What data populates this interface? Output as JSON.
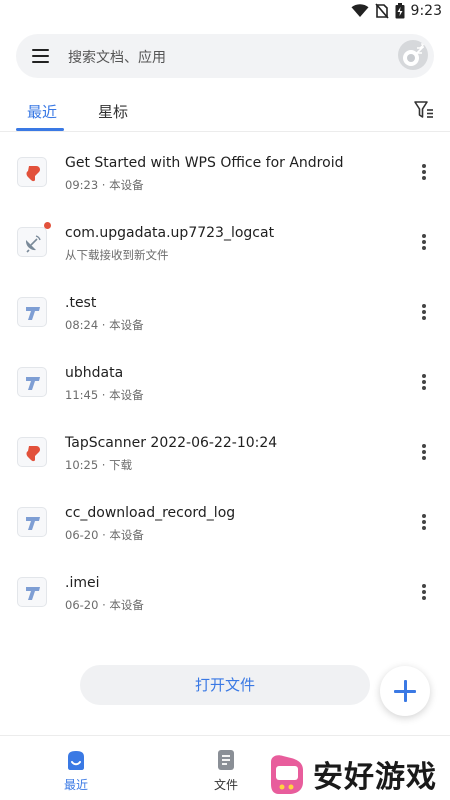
{
  "status_bar": {
    "time": "9:23",
    "icons": [
      "wifi-icon",
      "no-sim-icon",
      "battery-icon"
    ]
  },
  "search": {
    "placeholder": "搜索文档、应用",
    "menu_icon": "menu-icon",
    "avatar_icon": "avatar"
  },
  "tabs": [
    {
      "label": "最近",
      "active": true
    },
    {
      "label": "星标",
      "active": false
    }
  ],
  "filter_icon": "filter-icon",
  "files": [
    {
      "name": "Get Started with WPS Office for Android",
      "meta": "09:23 · 本设备",
      "icon": "pdf-icon"
    },
    {
      "name": "com.upgadata.up7723_logcat",
      "meta": "从下载接收到新文件",
      "icon": "satellite-icon",
      "badge": true
    },
    {
      "name": ".test",
      "meta": "08:24 · 本设备",
      "icon": "text-doc-icon"
    },
    {
      "name": "ubhdata",
      "meta": "11:45 · 本设备",
      "icon": "text-doc-icon"
    },
    {
      "name": "TapScanner 2022-06-22-10:24",
      "meta": "10:25 · 下载",
      "icon": "pdf-icon"
    },
    {
      "name": "cc_download_record_log",
      "meta": "06-20 · 本设备",
      "icon": "text-doc-icon"
    },
    {
      "name": ".imei",
      "meta": "06-20 · 本设备",
      "icon": "text-doc-icon"
    }
  ],
  "open_file_label": "打开文件",
  "fab_icon": "plus-icon",
  "bottom_nav": [
    {
      "label": "最近",
      "icon": "recent-icon",
      "active": true
    },
    {
      "label": "文件",
      "icon": "document-icon",
      "active": false
    }
  ],
  "watermark": {
    "text": "安好游戏"
  },
  "colors": {
    "accent": "#3a79e4",
    "pdf_red": "#e2513b",
    "text_icon_blue": "#7e9ed4"
  }
}
